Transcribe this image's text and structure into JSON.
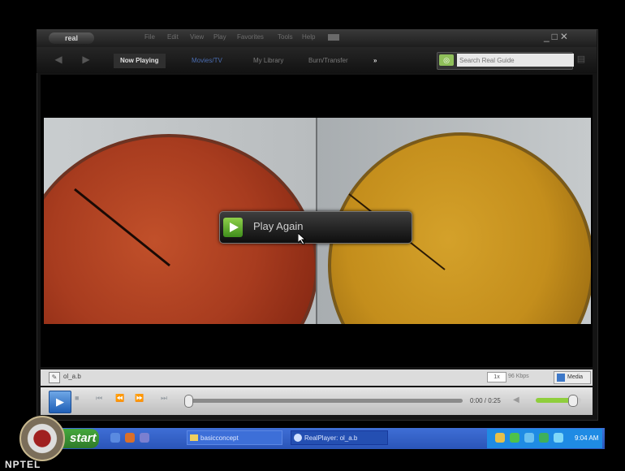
{
  "app": {
    "logo_text": "real"
  },
  "menu": [
    "File",
    "Edit",
    "View",
    "Play",
    "Favorites",
    "Tools",
    "Help"
  ],
  "tabs": [
    {
      "label": "Now Playing",
      "active": true
    },
    {
      "label": "Movies/TV",
      "active": false
    },
    {
      "label": "My Library",
      "active": false
    },
    {
      "label": "Burn/Transfer",
      "active": false
    },
    {
      "label": "»",
      "active": false
    }
  ],
  "search": {
    "placeholder": "Search Real Guide"
  },
  "overlay": {
    "play_again": "Play Again"
  },
  "status": {
    "clip_name": "ol_a.b",
    "zoom": "1x",
    "bitrate": "96 Kbps",
    "media_button": "Media"
  },
  "player": {
    "time": "0:00 / 0:25",
    "progress": 0.0,
    "volume": 0.8
  },
  "taskbar": {
    "start_label": "start",
    "folder_task": "basicconcept",
    "realplayer_task": "RealPlayer: ol_a.b",
    "clock": "9:04 AM"
  },
  "watermark": {
    "label": "NPTEL"
  },
  "colors": {
    "video_left": "#a83c1f",
    "video_right": "#c48e1c",
    "taskbar": "#2a55b8",
    "start_green": "#3c9a35",
    "volume_green": "#8fce3c"
  }
}
